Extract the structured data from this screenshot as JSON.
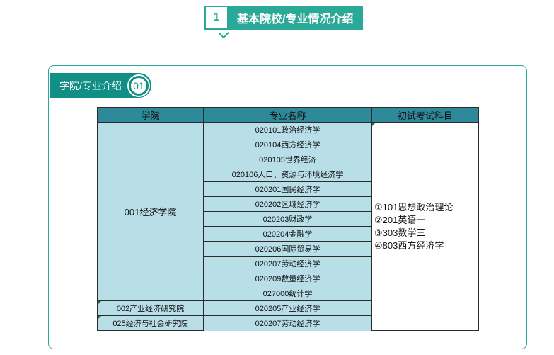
{
  "header": {
    "number": "1",
    "title": "基本院校/专业情况介绍"
  },
  "section": {
    "label": "学院/专业介绍",
    "number": "01"
  },
  "table": {
    "columns": [
      "学院",
      "专业名称",
      "初试考试科目"
    ],
    "colleges": [
      "001经济学院",
      "002产业经济研究院",
      "025经济与社会研究院"
    ],
    "majors": [
      "020101政治经济学",
      "020104西方经济学",
      "020105世界经济",
      "020106人口、资源与环境经济学",
      "020201国民经济学",
      "020202区域经济学",
      "020203财政学",
      "020204金融学",
      "020206国际贸易学",
      "020207劳动经济学",
      "020209数量经济学",
      "027000统计学",
      "020205产业经济学",
      "020207劳动经济学"
    ],
    "exams": [
      "①101思想政治理论",
      "②201英语一",
      "③303数学三",
      "④803西方经济学"
    ]
  },
  "colors": {
    "accent": "#2aa898",
    "tab": "#118f84",
    "header_row": "#2e8a9b",
    "cell": "#b8dee8"
  }
}
